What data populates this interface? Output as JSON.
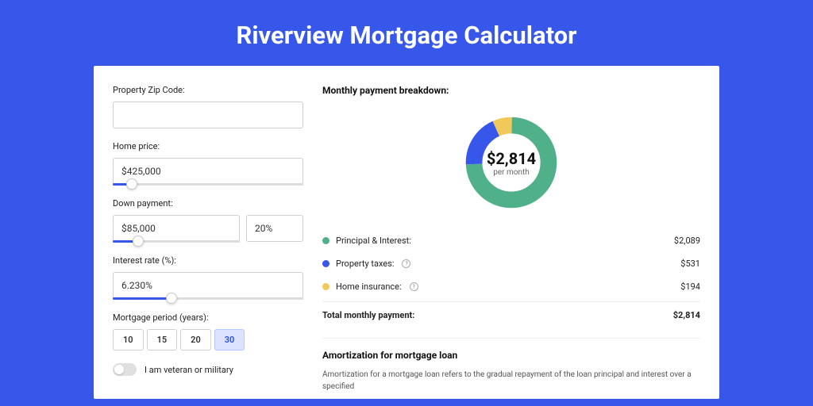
{
  "page_title": "Riverview Mortgage Calculator",
  "form": {
    "zip_label": "Property Zip Code:",
    "zip_value": "",
    "home_price_label": "Home price:",
    "home_price_value": "$425,000",
    "home_price_slider_pct": 10,
    "down_payment_label": "Down payment:",
    "down_payment_value": "$85,000",
    "down_payment_pct_value": "20%",
    "down_payment_slider_pct": 20,
    "interest_label": "Interest rate (%):",
    "interest_value": "6.230%",
    "interest_slider_pct": 31,
    "period_label": "Mortgage period (years):",
    "period_options": [
      "10",
      "15",
      "20",
      "30"
    ],
    "period_active": "30",
    "veteran_label": "I am veteran or military"
  },
  "breakdown": {
    "title": "Monthly payment breakdown:",
    "center_amount": "$2,814",
    "center_sub": "per month",
    "items": [
      {
        "label": "Principal & Interest:",
        "value": "$2,089",
        "color": "g"
      },
      {
        "label": "Property taxes:",
        "value": "$531",
        "color": "b",
        "info": true
      },
      {
        "label": "Home insurance:",
        "value": "$194",
        "color": "y",
        "info": true
      }
    ],
    "total_label": "Total monthly payment:",
    "total_value": "$2,814"
  },
  "chart_data": {
    "type": "pie",
    "title": "Monthly payment breakdown",
    "series": [
      {
        "name": "Principal & Interest",
        "value": 2089,
        "color": "#4fb08a"
      },
      {
        "name": "Property taxes",
        "value": 531,
        "color": "#3757eb"
      },
      {
        "name": "Home insurance",
        "value": 194,
        "color": "#f1c95b"
      }
    ],
    "total": 2814
  },
  "amort": {
    "title": "Amortization for mortgage loan",
    "text": "Amortization for a mortgage loan refers to the gradual repayment of the loan principal and interest over a specified"
  }
}
